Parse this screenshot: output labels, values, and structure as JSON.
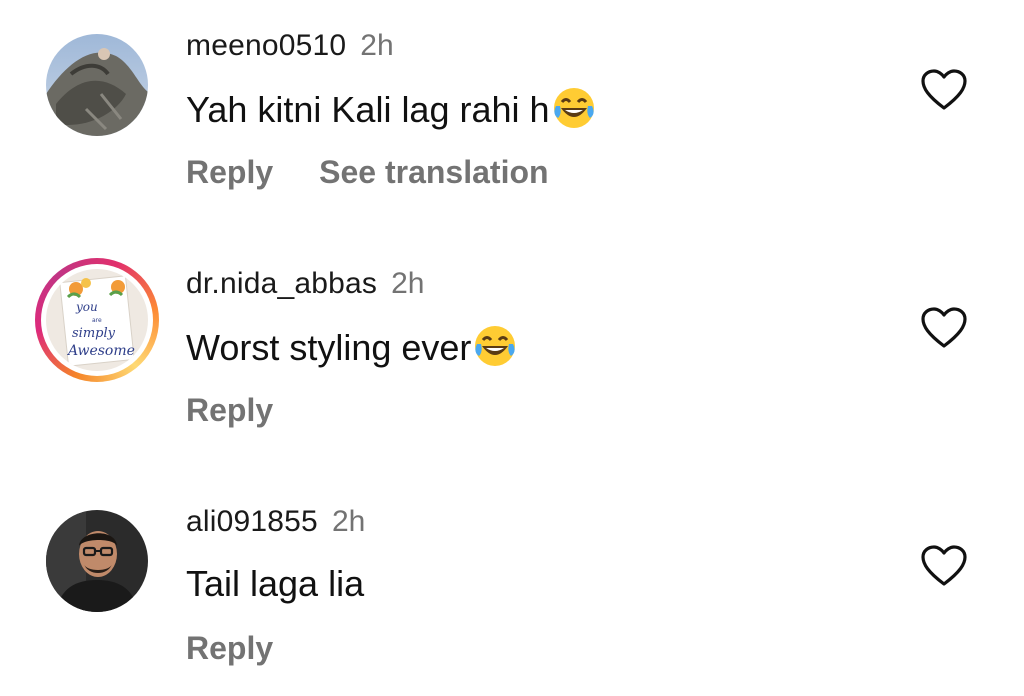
{
  "comments": [
    {
      "username": "meeno0510",
      "time": "2h",
      "text": "Yah kitni Kali lag rahi h",
      "emoji": "face-with-tears-of-joy",
      "actions": {
        "reply": "Reply",
        "translate": "See translation"
      },
      "like_icon": "heart-outline-icon"
    },
    {
      "username": "dr.nida_abbas",
      "time": "2h",
      "text": "Worst styling ever",
      "emoji": "face-with-tears-of-joy",
      "actions": {
        "reply": "Reply"
      },
      "like_icon": "heart-outline-icon",
      "avatar_text": [
        "you",
        "are",
        "simply",
        "Awesome"
      ]
    },
    {
      "username": "ali091855",
      "time": "2h",
      "text": "Tail laga lia",
      "actions": {
        "reply": "Reply"
      },
      "like_icon": "heart-outline-icon"
    }
  ],
  "colors": {
    "text_primary": "#111111",
    "text_secondary": "#737373",
    "story_ring_start": "#f58529",
    "story_ring_end": "#dd2a7b"
  }
}
